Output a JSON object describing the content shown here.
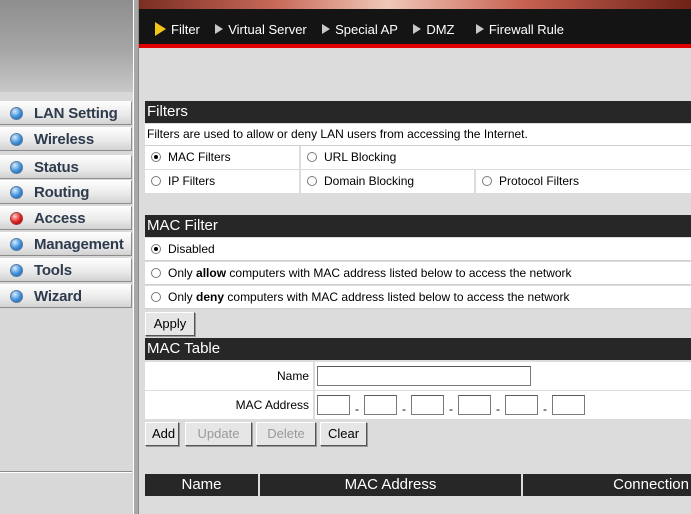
{
  "top_tabs": [
    {
      "label": "Filter",
      "active": true
    },
    {
      "label": "Virtual Server",
      "active": false
    },
    {
      "label": "Special AP",
      "active": false
    },
    {
      "label": "DMZ",
      "active": false
    },
    {
      "label": "Firewall Rule",
      "active": false
    }
  ],
  "sidebar": {
    "items": [
      {
        "label": "LAN Setting",
        "icon": "blue-orb-icon",
        "active": false
      },
      {
        "label": "Wireless",
        "icon": "blue-orb-icon",
        "active": false
      },
      {
        "label": "Status",
        "icon": "blue-orb-icon",
        "active": false
      },
      {
        "label": "Routing",
        "icon": "blue-orb-icon",
        "active": false
      },
      {
        "label": "Access",
        "icon": "red-orb-icon",
        "active": true
      },
      {
        "label": "Management",
        "icon": "blue-orb-icon",
        "active": false
      },
      {
        "label": "Tools",
        "icon": "blue-orb-icon",
        "active": false
      },
      {
        "label": "Wizard",
        "icon": "blue-orb-icon",
        "active": false
      }
    ]
  },
  "filters": {
    "title": "Filters",
    "description": "Filters are used to allow or deny LAN users from accessing the Internet.",
    "options": {
      "mac": {
        "label": "MAC Filters",
        "selected": true
      },
      "url": {
        "label": "URL Blocking",
        "selected": false
      },
      "ip": {
        "label": "IP Filters",
        "selected": false
      },
      "domain": {
        "label": "Domain Blocking",
        "selected": false
      },
      "protocol": {
        "label": "Protocol Filters",
        "selected": false
      }
    }
  },
  "mac_filter": {
    "title": "MAC Filter",
    "disabled_label": "Disabled",
    "allow_pre": "Only",
    "allow_bold": "allow",
    "allow_post": "computers with MAC address listed below to access the network",
    "deny_pre": "Only",
    "deny_bold": "deny",
    "deny_post": "computers with MAC address listed below to access the network",
    "selected": "disabled",
    "apply_label": "Apply"
  },
  "mac_table": {
    "title": "MAC Table",
    "name_label": "Name",
    "name_value": "",
    "mac_label": "MAC Address",
    "mac_octets": [
      "",
      "",
      "",
      "",
      "",
      ""
    ],
    "separator": "-",
    "buttons": {
      "add": "Add",
      "update": "Update",
      "delete": "Delete",
      "clear": "Clear"
    },
    "columns": [
      "Name",
      "MAC Address",
      "Connection"
    ]
  },
  "colors": {
    "header_bar": "#272727",
    "accent_red": "#e10000",
    "active_tab_arrow": "#f5c419"
  }
}
